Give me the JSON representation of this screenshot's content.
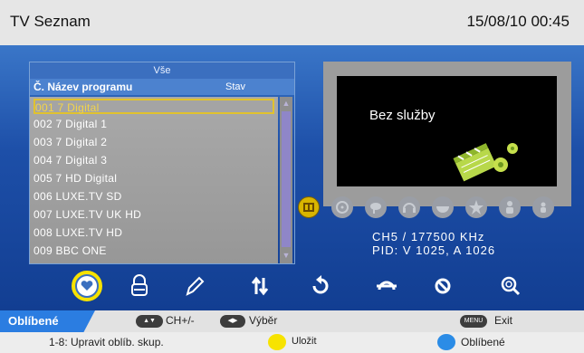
{
  "header": {
    "title": "TV Seznam",
    "datetime": "15/08/10  00:45"
  },
  "list": {
    "group": "Vše",
    "col_name": "Č. Název programu",
    "col_state": "Stav",
    "rows": [
      "001  7  Digital",
      "002  7  Digital  1",
      "003  7  Digital   2",
      "004  7  Digital   3",
      "005  7  HD  Digital",
      "006  LUXE.TV SD",
      "007  LUXE.TV UK  HD",
      "008  LUXE.TV HD",
      "009  BBC  ONE"
    ],
    "selected_index": 0
  },
  "preview": {
    "status": "Bez služby"
  },
  "info": {
    "line1": "CH5 / 177500  KHz",
    "line2": "PID: V 1025, A 1026"
  },
  "icons": {
    "channel_flags": [
      "tv-flag-icon",
      "film-icon",
      "pet-icon",
      "music-icon",
      "bowl-icon",
      "star-icon",
      "person-icon",
      "child-icon"
    ],
    "tools": [
      "favorite-icon",
      "lock-icon",
      "edit-icon",
      "move-icon",
      "rotate-icon",
      "skip-icon",
      "delete-icon",
      "search-icon"
    ]
  },
  "footer": {
    "tab": "Oblíbené",
    "key1_label": "CH+/-",
    "key2_label": "Výběr",
    "menu_key": "MENU",
    "menu_label": "Exit",
    "hint": "1-8: Upravit oblíb. skup.",
    "yellow_label": "Uložit",
    "blue_label": "Oblíbené"
  },
  "colors": {
    "highlight": "#f6e200",
    "yellow_button": "#f7e300",
    "blue_button": "#2b8ce6"
  }
}
